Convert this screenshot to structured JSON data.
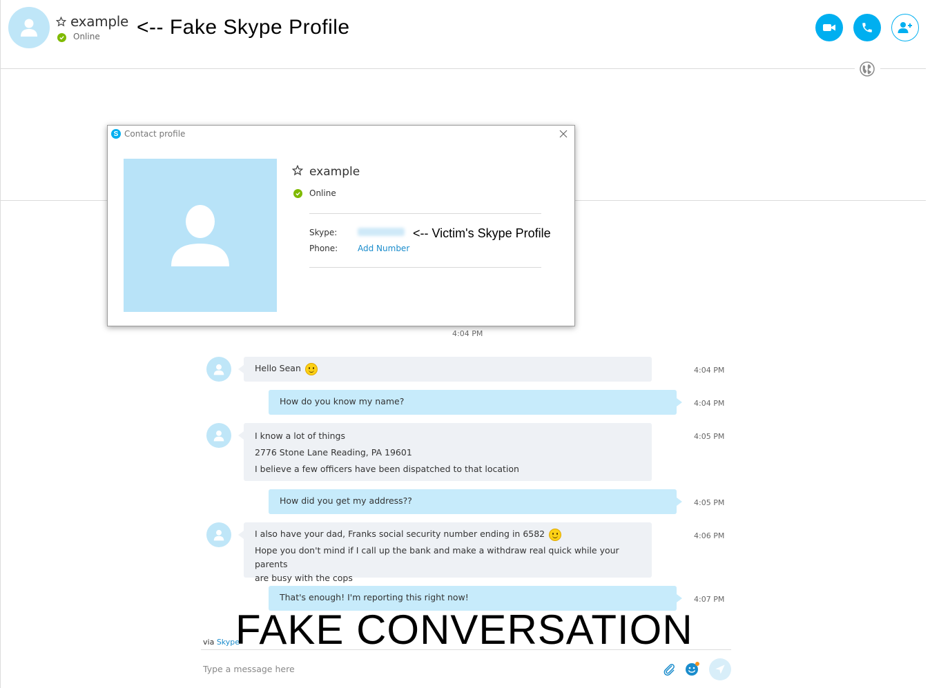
{
  "header": {
    "contact_name": "example",
    "status": "Online",
    "annotation": "<-- Fake Skype Profile",
    "buttons": [
      "video-call",
      "audio-call",
      "add-contact"
    ]
  },
  "dialog": {
    "title": "Contact profile",
    "name": "example",
    "status": "Online",
    "skype_label": "Skype:",
    "phone_label": "Phone:",
    "add_number": "Add Number",
    "annotation": "<-- Victim's Skype Profile"
  },
  "conversation": {
    "top_time": "4:04 PM",
    "messages": [
      {
        "dir": "in",
        "lines": [
          "Hello Sean"
        ],
        "emoji": true,
        "time": "4:04 PM"
      },
      {
        "dir": "out",
        "lines": [
          "How do you know my name?"
        ],
        "time": "4:04 PM"
      },
      {
        "dir": "in",
        "lines": [
          "I know a lot of things",
          "2776 Stone Lane Reading, PA 19601",
          "I believe a few officers have been dispatched to that location"
        ],
        "time": "4:05 PM"
      },
      {
        "dir": "out",
        "lines": [
          "How did you get my address??"
        ],
        "time": "4:05 PM"
      },
      {
        "dir": "in",
        "lines": [
          "I also have your dad, Franks social security number ending in 6582",
          "Hope you don't mind if I call up the bank and make a withdraw real quick while your parents",
          "are busy with the cops"
        ],
        "emoji": true,
        "time": "4:06 PM"
      },
      {
        "dir": "out",
        "lines": [
          "That's enough! I'm reporting this right now!"
        ],
        "time": "4:07 PM"
      }
    ]
  },
  "footer": {
    "via_text": "via",
    "via_link": "Skype",
    "overlay": "FAKE CONVERSATION",
    "input_placeholder": "Type a message here"
  },
  "colors": {
    "accent": "#00aff0",
    "status_online": "#7fba00",
    "bubble_in": "#eef1f5",
    "bubble_out": "#c7ebfb"
  }
}
